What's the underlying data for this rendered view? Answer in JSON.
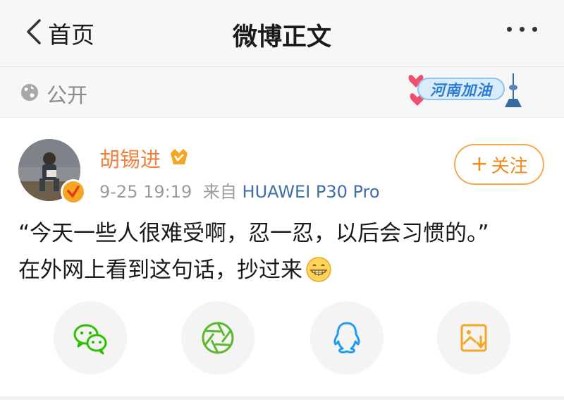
{
  "header": {
    "back_label": "首页",
    "title": "微博正文",
    "more_icon": "more-dots-icon"
  },
  "visibility": {
    "label": "公开",
    "icon": "globe-icon",
    "badge_text": "河南加油"
  },
  "post": {
    "author": "胡锡进",
    "timestamp": "9-25 19:19",
    "from_label": "来自",
    "source": "HUAWEI P30 Pro",
    "follow_label": "关注",
    "text_line1": "“今天一些人很难受啊，忍一忍，以后会习惯的。”",
    "text_line2": "在外网上看到这句话，抄过来",
    "emoji": "grin-emoji"
  },
  "share": {
    "items": [
      "wechat-icon",
      "moments-icon",
      "qq-icon",
      "save-image-icon"
    ]
  },
  "colors": {
    "author": "#f0803a",
    "follow": "#f08a1c",
    "source": "#3f6fa8",
    "wechat": "#2dc100",
    "moments": "#5db82e",
    "qq": "#1e9df0",
    "save": "#f5a623"
  }
}
